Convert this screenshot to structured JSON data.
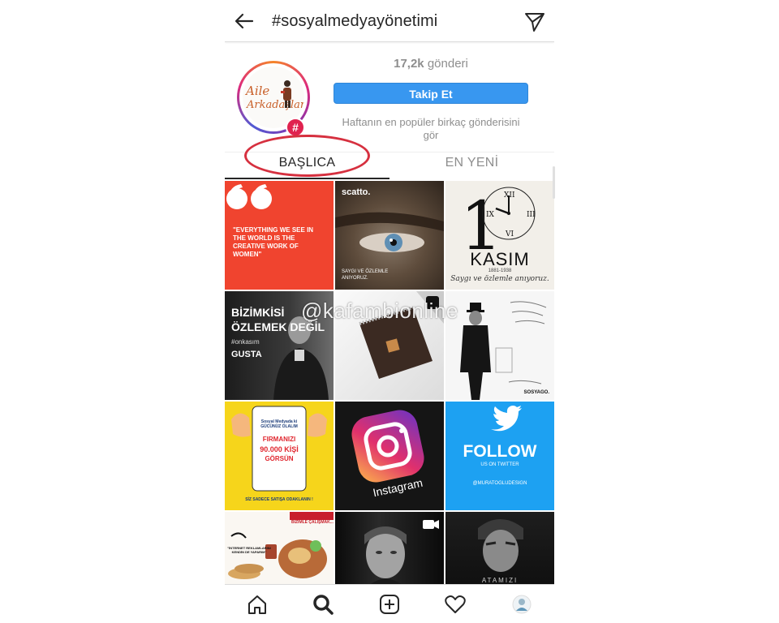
{
  "header": {
    "title": "#sosyalmedyayönetimi",
    "back_icon": "arrow-left-icon",
    "send_icon": "paper-plane-icon"
  },
  "profile": {
    "logo_line1": "Aile",
    "logo_line2": "Arkadaşlar",
    "badge": "#",
    "posts_count": "17,2k",
    "posts_label": "gönderi",
    "follow_label": "Takip Et",
    "hint": "Haftanın en popüler birkaç gönderisini gör"
  },
  "tabs": {
    "top": "BAŞLICA",
    "recent": "EN YENİ"
  },
  "grid": {
    "p1_quote": "\"EVERYTHING WE SEE IN THE WORLD IS THE CREATIVE WORK OF WOMEN\"",
    "p2_brand": "scatto.",
    "p2_caption": "SAYGI VE ÖZLEMLE ANIYORUZ.",
    "p3_title": "KASIM",
    "p3_years": "1881-1938",
    "p3_sub": "Saygı ve özlemle anıyoruz.",
    "p4_line1": "BİZİMKİSİ",
    "p4_line2": "ÖZLEMEK DEĞİL",
    "p4_tag": "#onkasım",
    "p4_brand": "GUSTA",
    "p6_brand": "SOSYAGO.",
    "p7_title": "Sosyal Medyada ki GÜCÜNÜZ OLALIM",
    "p7_firm": "FIRMANIZI",
    "p7_num": "90.000",
    "p7_kisi": "KİŞİ",
    "p7_gorsun": "GÖRSÜN",
    "p7_footer": "SİZ SADECE SATIŞA ODAKLANIN !",
    "p8_label": "Instagram",
    "p9_follow": "FOLLOW",
    "p9_sub": "US ON TWITTER",
    "p9_handle": "@MURATOGLUDESIGN",
    "p10_banner": "BİZİMLE ÇALIŞMAK...",
    "p10_text": "\"İNTERNET REKLAMLARINI KENDİN DE YAPARIM\"",
    "p12_label": "ATAMIZI"
  },
  "watermark": "@kafambionline",
  "bottom_nav": [
    {
      "icon": "home-icon"
    },
    {
      "icon": "search-icon"
    },
    {
      "icon": "add-post-icon"
    },
    {
      "icon": "heart-icon"
    },
    {
      "icon": "profile-avatar-icon"
    }
  ],
  "colors": {
    "accent": "#3897f0",
    "highlight_circle": "#d6303f",
    "badge": "#e0224f"
  }
}
